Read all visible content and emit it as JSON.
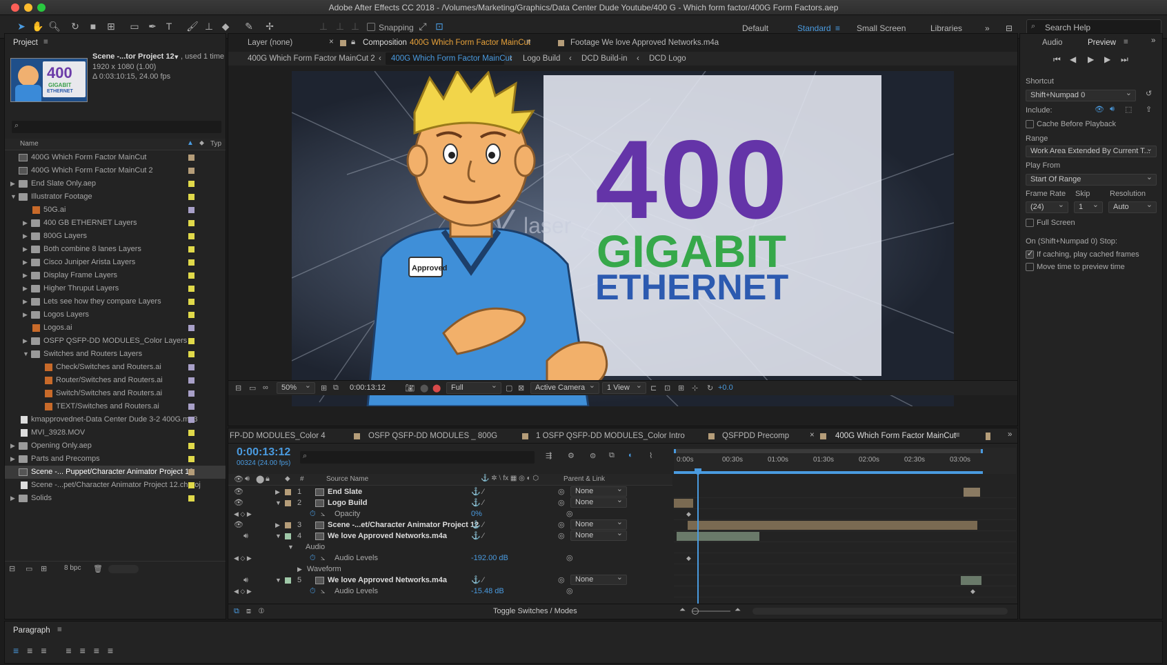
{
  "app": {
    "title": "Adobe After Effects CC 2018 - /Volumes/Marketing/Graphics/Data Center Dude Youtube/400 G - Which form factor/400G Form Factors.aep"
  },
  "toolbar": {
    "snapping_label": "Snapping"
  },
  "workspaces": {
    "items": [
      "Default",
      "Standard",
      "Small Screen",
      "Libraries"
    ],
    "active": "Standard"
  },
  "search_help": {
    "placeholder": "Search Help"
  },
  "project": {
    "tab": "Project",
    "selected_name": "Scene -...tor Project 12",
    "used": ", used 1 time",
    "dims": "1920 x 1080 (1.00)",
    "duration": "Δ 0:03:10:15, 24.00 fps",
    "col_name": "Name",
    "col_type": "Typ",
    "bpc": "8 bpc",
    "items": [
      {
        "name": "400G Which Form Factor MainCut",
        "indent": 0,
        "kind": "comp",
        "color": "#b59d79",
        "arrow": ""
      },
      {
        "name": "400G Which Form Factor MainCut 2",
        "indent": 0,
        "kind": "comp",
        "color": "#b59d79",
        "arrow": ""
      },
      {
        "name": "End Slate Only.aep",
        "indent": 0,
        "kind": "folder",
        "color": "#e0d94a",
        "arrow": "▶"
      },
      {
        "name": "Illustrator Footage",
        "indent": 0,
        "kind": "folder",
        "color": "#e0d94a",
        "arrow": "▼"
      },
      {
        "name": "50G.ai",
        "indent": 1,
        "kind": "ai",
        "color": "#a8a0c8",
        "arrow": ""
      },
      {
        "name": "400 GB ETHERNET Layers",
        "indent": 1,
        "kind": "folder",
        "color": "#e0d94a",
        "arrow": "▶"
      },
      {
        "name": "800G Layers",
        "indent": 1,
        "kind": "folder",
        "color": "#e0d94a",
        "arrow": "▶"
      },
      {
        "name": "Both combine 8 lanes Layers",
        "indent": 1,
        "kind": "folder",
        "color": "#e0d94a",
        "arrow": "▶"
      },
      {
        "name": "Cisco Juniper Arista Layers",
        "indent": 1,
        "kind": "folder",
        "color": "#e0d94a",
        "arrow": "▶"
      },
      {
        "name": "Display Frame Layers",
        "indent": 1,
        "kind": "folder",
        "color": "#e0d94a",
        "arrow": "▶"
      },
      {
        "name": "Higher Thruput Layers",
        "indent": 1,
        "kind": "folder",
        "color": "#e0d94a",
        "arrow": "▶"
      },
      {
        "name": "Lets see how they compare Layers",
        "indent": 1,
        "kind": "folder",
        "color": "#e0d94a",
        "arrow": "▶"
      },
      {
        "name": "Logos Layers",
        "indent": 1,
        "kind": "folder",
        "color": "#e0d94a",
        "arrow": "▶"
      },
      {
        "name": "Logos.ai",
        "indent": 1,
        "kind": "ai",
        "color": "#a8a0c8",
        "arrow": ""
      },
      {
        "name": "OSFP QSFP-DD MODULES_Color Layers",
        "indent": 1,
        "kind": "folder",
        "color": "#e0d94a",
        "arrow": "▶"
      },
      {
        "name": "Switches and Routers Layers",
        "indent": 1,
        "kind": "folder",
        "color": "#e0d94a",
        "arrow": "▼"
      },
      {
        "name": "Check/Switches and Routers.ai",
        "indent": 2,
        "kind": "ai",
        "color": "#a8a0c8",
        "arrow": ""
      },
      {
        "name": "Router/Switches and Routers.ai",
        "indent": 2,
        "kind": "ai",
        "color": "#a8a0c8",
        "arrow": ""
      },
      {
        "name": "Switch/Switches and Routers.ai",
        "indent": 2,
        "kind": "ai",
        "color": "#a8a0c8",
        "arrow": ""
      },
      {
        "name": "TEXT/Switches and Routers.ai",
        "indent": 2,
        "kind": "ai",
        "color": "#a8a0c8",
        "arrow": ""
      },
      {
        "name": "kmapprovednet-Data Center Dude 3-2 400G.mp3",
        "indent": 0,
        "kind": "file",
        "color": "#a8a0c8",
        "arrow": ""
      },
      {
        "name": "MVI_3928.MOV",
        "indent": 0,
        "kind": "file",
        "color": "#e0d94a",
        "arrow": ""
      },
      {
        "name": "Opening Only.aep",
        "indent": 0,
        "kind": "folder",
        "color": "#e0d94a",
        "arrow": "▶"
      },
      {
        "name": "Parts and Precomps",
        "indent": 0,
        "kind": "folder",
        "color": "#e0d94a",
        "arrow": "▶"
      },
      {
        "name": "Scene -... Puppet/Character Animator Project 12",
        "indent": 0,
        "kind": "comp",
        "color": "#b59d79",
        "arrow": "",
        "selected": true
      },
      {
        "name": "Scene -...pet/Character Animator Project 12.chproj",
        "indent": 0,
        "kind": "file",
        "color": "#e0d94a",
        "arrow": ""
      },
      {
        "name": "Solids",
        "indent": 0,
        "kind": "folder",
        "color": "#e0d94a",
        "arrow": "▶"
      }
    ]
  },
  "viewer": {
    "tab_layer": "Layer (none)",
    "tab_comp_prefix": "Composition",
    "tab_comp_name": "400G Which Form Factor MainCut",
    "tab_footage": "Footage We love Approved Networks.m4a",
    "crumbs": [
      "400G Which Form Factor MainCut 2",
      "400G Which Form Factor MainCut",
      "Logo Build",
      "DCD Build-in",
      "DCD Logo"
    ],
    "frame_text": {
      "big": "400",
      "mid": "GIGABIT",
      "low": "ETHERNET",
      "badge": "Approved",
      "laser": "laser",
      "v": "V"
    },
    "zoom": "50%",
    "time": "0:00:13:12",
    "resolution": "Full",
    "camera": "Active Camera",
    "views": "1 View",
    "exposure": "+0.0"
  },
  "preview": {
    "tab_audio": "Audio",
    "tab_preview": "Preview",
    "shortcut_label": "Shortcut",
    "shortcut_value": "Shift+Numpad 0",
    "include_label": "Include:",
    "cache_label": "Cache Before Playback",
    "range_label": "Range",
    "range_value": "Work Area Extended By Current T...",
    "play_from_label": "Play From",
    "play_from_value": "Start Of Range",
    "frame_rate_label": "Frame Rate",
    "skip_label": "Skip",
    "resolution_label": "Resolution",
    "frame_rate_value": "(24)",
    "skip_value": "1",
    "resolution_value": "Auto",
    "fullscreen_label": "Full Screen",
    "stop_label": "On (Shift+Numpad 0) Stop:",
    "if_caching_label": "If caching, play cached frames",
    "move_time_label": "Move time to preview time"
  },
  "timeline": {
    "tabs": [
      "FP-DD MODULES_Color 4",
      "OSFP QSFP-DD MODULES _ 800G",
      "1 OSFP QSFP-DD MODULES_Color Intro",
      "QSFPDD Precomp",
      "400G Which Form Factor MainCut"
    ],
    "timecode": "0:00:13:12",
    "frames": "00324 (24.00 fps)",
    "col_source": "Source Name",
    "col_parent": "Parent & Link",
    "ruler": [
      "0:00s",
      "00:30s",
      "01:00s",
      "01:30s",
      "02:00s",
      "02:30s",
      "03:00s"
    ],
    "toggle_label": "Toggle Switches / Modes",
    "rows": [
      {
        "kind": "layer",
        "num": "1",
        "name": "End Slate",
        "parent": "None",
        "color": "#b59d79",
        "arrow": "▶",
        "eye": true
      },
      {
        "kind": "layer",
        "num": "2",
        "name": "Logo Build",
        "parent": "None",
        "color": "#b59d79",
        "arrow": "▼",
        "eye": true
      },
      {
        "kind": "prop",
        "name": "Opacity",
        "value": "0%"
      },
      {
        "kind": "layer",
        "num": "3",
        "name": "Scene -...et/Character Animator Project 12",
        "parent": "None",
        "color": "#b59d79",
        "arrow": "▶",
        "eye": true
      },
      {
        "kind": "layer",
        "num": "4",
        "name": "We love Approved Networks.m4a",
        "parent": "None",
        "color": "#9fc8a8",
        "arrow": "▼",
        "eye": false
      },
      {
        "kind": "group",
        "name": "Audio",
        "level": 1
      },
      {
        "kind": "prop",
        "name": "Audio Levels",
        "value": "-192.00 dB"
      },
      {
        "kind": "group",
        "name": "Waveform",
        "level": 2
      },
      {
        "kind": "layer",
        "num": "5",
        "name": "We love Approved Networks.m4a",
        "parent": "None",
        "color": "#9fc8a8",
        "arrow": "▼",
        "eye": false
      },
      {
        "kind": "prop",
        "name": "Audio Levels",
        "value": "-15.48 dB"
      }
    ]
  },
  "paragraph": {
    "tab": "Paragraph"
  }
}
